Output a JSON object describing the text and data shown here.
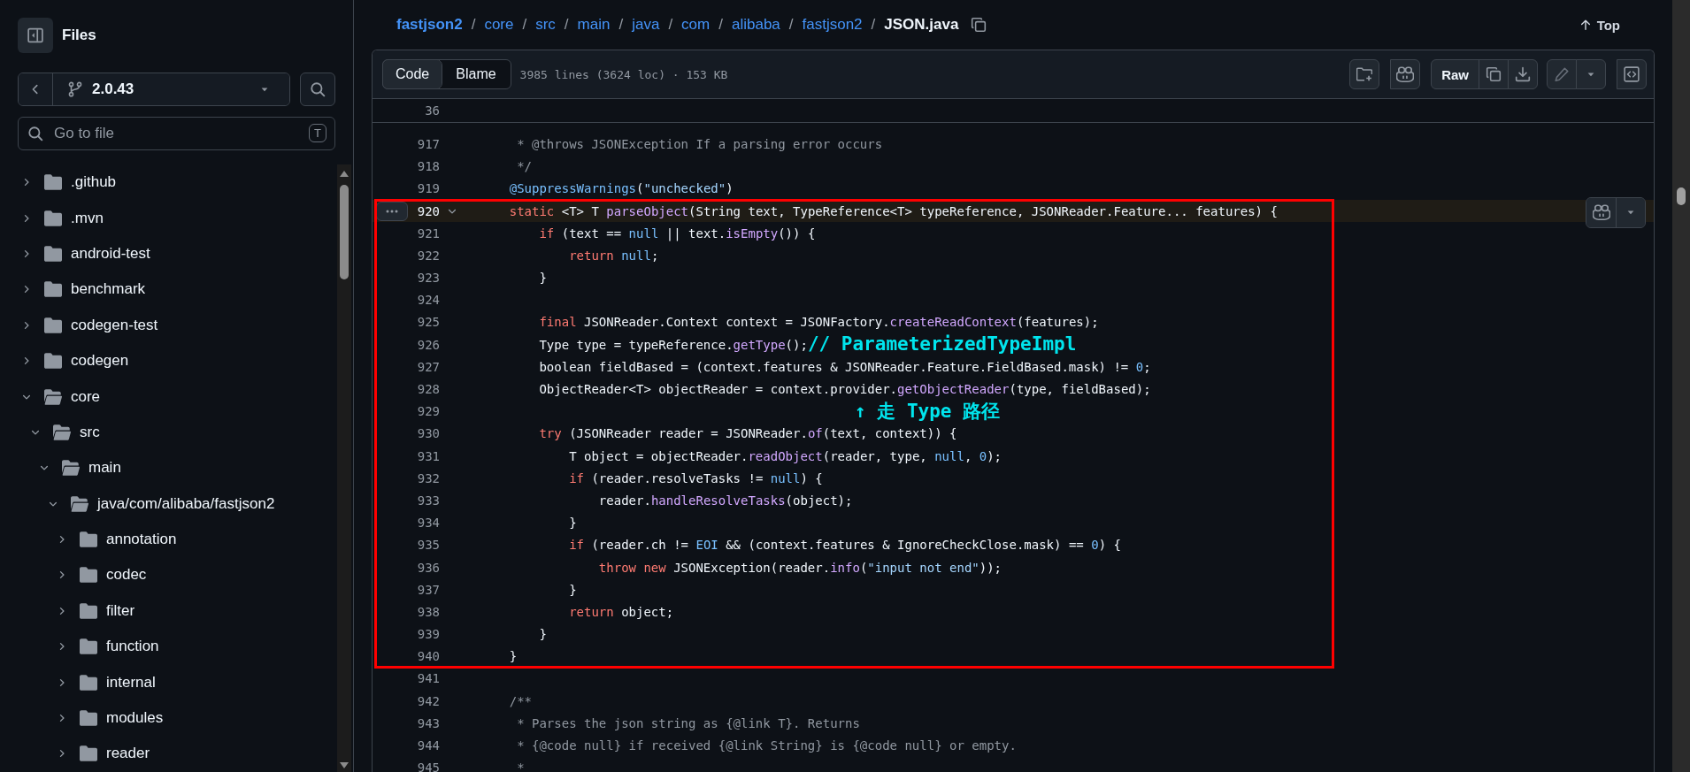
{
  "sidebar": {
    "title": "Files",
    "branch": "2.0.43",
    "search": {
      "placeholder": "Go to file",
      "shortcut": "T"
    },
    "tree": [
      {
        "name": ".github",
        "expanded": false
      },
      {
        "name": ".mvn",
        "expanded": false
      },
      {
        "name": "android-test",
        "expanded": false
      },
      {
        "name": "benchmark",
        "expanded": false
      },
      {
        "name": "codegen-test",
        "expanded": false
      },
      {
        "name": "codegen",
        "expanded": false
      },
      {
        "name": "core",
        "expanded": true,
        "children": [
          {
            "name": "src",
            "expanded": true,
            "children": [
              {
                "name": "main",
                "expanded": true,
                "children": [
                  {
                    "name": "java/com/alibaba/fastjson2",
                    "expanded": true,
                    "children": [
                      {
                        "name": "annotation",
                        "expanded": false
                      },
                      {
                        "name": "codec",
                        "expanded": false
                      },
                      {
                        "name": "filter",
                        "expanded": false
                      },
                      {
                        "name": "function",
                        "expanded": false
                      },
                      {
                        "name": "internal",
                        "expanded": false
                      },
                      {
                        "name": "modules",
                        "expanded": false
                      },
                      {
                        "name": "reader",
                        "expanded": false
                      }
                    ]
                  }
                ]
              }
            ]
          }
        ]
      }
    ]
  },
  "breadcrumb": {
    "path": [
      "fastjson2",
      "core",
      "src",
      "main",
      "java",
      "com",
      "alibaba",
      "fastjson2"
    ],
    "separator": "/",
    "file": "JSON.java",
    "top_link": "Top"
  },
  "file": {
    "tabs": [
      {
        "label": "Code",
        "selected": true
      },
      {
        "label": "Blame",
        "selected": false
      }
    ],
    "info": "3985 lines (3624 loc) · 153 KB",
    "raw_button": "Raw"
  },
  "code": {
    "sticky_line": "36",
    "lines": [
      {
        "number": "917",
        "selected": false,
        "boxed": false,
        "tokens": [
          {
            "kind": "comment",
            "text": "     * @throws JSONException If a parsing error occurs"
          }
        ]
      },
      {
        "number": "918",
        "selected": false,
        "boxed": false,
        "tokens": [
          {
            "kind": "comment",
            "text": "     */"
          }
        ]
      },
      {
        "number": "919",
        "selected": false,
        "boxed": false,
        "tokens": [
          {
            "kind": "const",
            "text": "    @SuppressWarnings"
          },
          {
            "kind": "plain",
            "text": "("
          },
          {
            "kind": "string",
            "text": "\"unchecked\""
          },
          {
            "kind": "plain",
            "text": ")"
          }
        ]
      },
      {
        "number": "920",
        "selected": true,
        "boxed": true,
        "tokens": [
          {
            "kind": "keyword",
            "text": "    static"
          },
          {
            "kind": "plain",
            "text": " <T> T "
          },
          {
            "kind": "func",
            "text": "parseObject"
          },
          {
            "kind": "plain",
            "text": "(String text, TypeReference<T> typeReference, JSONReader.Feature... features) {"
          }
        ]
      },
      {
        "number": "921",
        "selected": false,
        "boxed": true,
        "tokens": [
          {
            "kind": "keyword",
            "text": "        if"
          },
          {
            "kind": "plain",
            "text": " (text == "
          },
          {
            "kind": "const",
            "text": "null"
          },
          {
            "kind": "plain",
            "text": " || text."
          },
          {
            "kind": "func",
            "text": "isEmpty"
          },
          {
            "kind": "plain",
            "text": "()) {"
          }
        ]
      },
      {
        "number": "922",
        "selected": false,
        "boxed": true,
        "tokens": [
          {
            "kind": "keyword",
            "text": "            return"
          },
          {
            "kind": "const",
            "text": " null"
          },
          {
            "kind": "plain",
            "text": ";"
          }
        ]
      },
      {
        "number": "923",
        "selected": false,
        "boxed": true,
        "tokens": [
          {
            "kind": "plain",
            "text": "        }"
          }
        ]
      },
      {
        "number": "924",
        "selected": false,
        "boxed": true
      },
      {
        "number": "925",
        "selected": false,
        "boxed": true,
        "tokens": [
          {
            "kind": "keyword",
            "text": "        final"
          },
          {
            "kind": "plain",
            "text": " JSONReader.Context context = JSONFactory."
          },
          {
            "kind": "func",
            "text": "createReadContext"
          },
          {
            "kind": "plain",
            "text": "(features);"
          }
        ]
      },
      {
        "number": "926",
        "selected": false,
        "boxed": true,
        "tokens": [
          {
            "kind": "plain",
            "text": "        Type type = typeReference."
          },
          {
            "kind": "func",
            "text": "getType"
          },
          {
            "kind": "plain",
            "text": "();"
          },
          {
            "kind": "note",
            "text": "// ParameterizedTypeImpl"
          }
        ]
      },
      {
        "number": "927",
        "selected": false,
        "boxed": true,
        "tokens": [
          {
            "kind": "plain",
            "text": "        boolean fieldBased = (context.features & JSONReader.Feature.FieldBased.mask) != "
          },
          {
            "kind": "const",
            "text": "0"
          },
          {
            "kind": "plain",
            "text": ";"
          }
        ]
      },
      {
        "number": "928",
        "selected": false,
        "boxed": true,
        "tokens": [
          {
            "kind": "plain",
            "text": "        ObjectReader<T> objectReader = context.provider."
          },
          {
            "kind": "func",
            "text": "getObjectReader"
          },
          {
            "kind": "plain",
            "text": "(type, fieldBased);"
          }
        ]
      },
      {
        "number": "929",
        "selected": false,
        "boxed": true,
        "tokens": [
          {
            "kind": "note",
            "text": "↑ 走 Type 路径"
          }
        ]
      },
      {
        "number": "930",
        "selected": false,
        "boxed": true,
        "tokens": [
          {
            "kind": "keyword",
            "text": "        try"
          },
          {
            "kind": "plain",
            "text": " (JSONReader reader = JSONReader."
          },
          {
            "kind": "func",
            "text": "of"
          },
          {
            "kind": "plain",
            "text": "(text, context)) {"
          }
        ]
      },
      {
        "number": "931",
        "selected": false,
        "boxed": true,
        "tokens": [
          {
            "kind": "plain",
            "text": "            T object = objectReader."
          },
          {
            "kind": "func",
            "text": "readObject"
          },
          {
            "kind": "plain",
            "text": "(reader, type, "
          },
          {
            "kind": "const",
            "text": "null"
          },
          {
            "kind": "plain",
            "text": ", "
          },
          {
            "kind": "const",
            "text": "0"
          },
          {
            "kind": "plain",
            "text": ");"
          }
        ]
      },
      {
        "number": "932",
        "selected": false,
        "boxed": true,
        "tokens": [
          {
            "kind": "keyword",
            "text": "            if"
          },
          {
            "kind": "plain",
            "text": " (reader.resolveTasks != "
          },
          {
            "kind": "const",
            "text": "null"
          },
          {
            "kind": "plain",
            "text": ") {"
          }
        ]
      },
      {
        "number": "933",
        "selected": false,
        "boxed": true,
        "tokens": [
          {
            "kind": "plain",
            "text": "                reader."
          },
          {
            "kind": "func",
            "text": "handleResolveTasks"
          },
          {
            "kind": "plain",
            "text": "(object);"
          }
        ]
      },
      {
        "number": "934",
        "selected": false,
        "boxed": true,
        "tokens": [
          {
            "kind": "plain",
            "text": "            }"
          }
        ]
      },
      {
        "number": "935",
        "selected": false,
        "boxed": true,
        "tokens": [
          {
            "kind": "keyword",
            "text": "            if"
          },
          {
            "kind": "plain",
            "text": " (reader.ch != "
          },
          {
            "kind": "const",
            "text": "EOI"
          },
          {
            "kind": "plain",
            "text": " && (context.features & IgnoreCheckClose.mask) == "
          },
          {
            "kind": "const",
            "text": "0"
          },
          {
            "kind": "plain",
            "text": ") {"
          }
        ]
      },
      {
        "number": "936",
        "selected": false,
        "boxed": true,
        "tokens": [
          {
            "kind": "keyword",
            "text": "                throw new"
          },
          {
            "kind": "plain",
            "text": " JSONException(reader."
          },
          {
            "kind": "func",
            "text": "info"
          },
          {
            "kind": "plain",
            "text": "("
          },
          {
            "kind": "string",
            "text": "\"input not end\""
          },
          {
            "kind": "plain",
            "text": "));"
          }
        ]
      },
      {
        "number": "937",
        "selected": false,
        "boxed": true,
        "tokens": [
          {
            "kind": "plain",
            "text": "            }"
          }
        ]
      },
      {
        "number": "938",
        "selected": false,
        "boxed": true,
        "tokens": [
          {
            "kind": "keyword",
            "text": "            return"
          },
          {
            "kind": "plain",
            "text": " object;"
          }
        ]
      },
      {
        "number": "939",
        "selected": false,
        "boxed": true,
        "tokens": [
          {
            "kind": "plain",
            "text": "        }"
          }
        ]
      },
      {
        "number": "940",
        "selected": false,
        "boxed": true,
        "tokens": [
          {
            "kind": "plain",
            "text": "    }"
          }
        ]
      },
      {
        "number": "941",
        "selected": false,
        "boxed": false
      },
      {
        "number": "942",
        "selected": false,
        "boxed": false,
        "tokens": [
          {
            "kind": "comment",
            "text": "    /**"
          }
        ]
      },
      {
        "number": "943",
        "selected": false,
        "boxed": false,
        "tokens": [
          {
            "kind": "comment",
            "text": "     * Parses the json string as {@link T}. Returns"
          }
        ]
      },
      {
        "number": "944",
        "selected": false,
        "boxed": false,
        "tokens": [
          {
            "kind": "comment",
            "text": "     * {@code null} if received {@link String} is {@code null} or empty."
          }
        ]
      },
      {
        "number": "945",
        "selected": false,
        "boxed": false,
        "tokens": [
          {
            "kind": "comment",
            "text": "     *"
          }
        ]
      }
    ]
  }
}
